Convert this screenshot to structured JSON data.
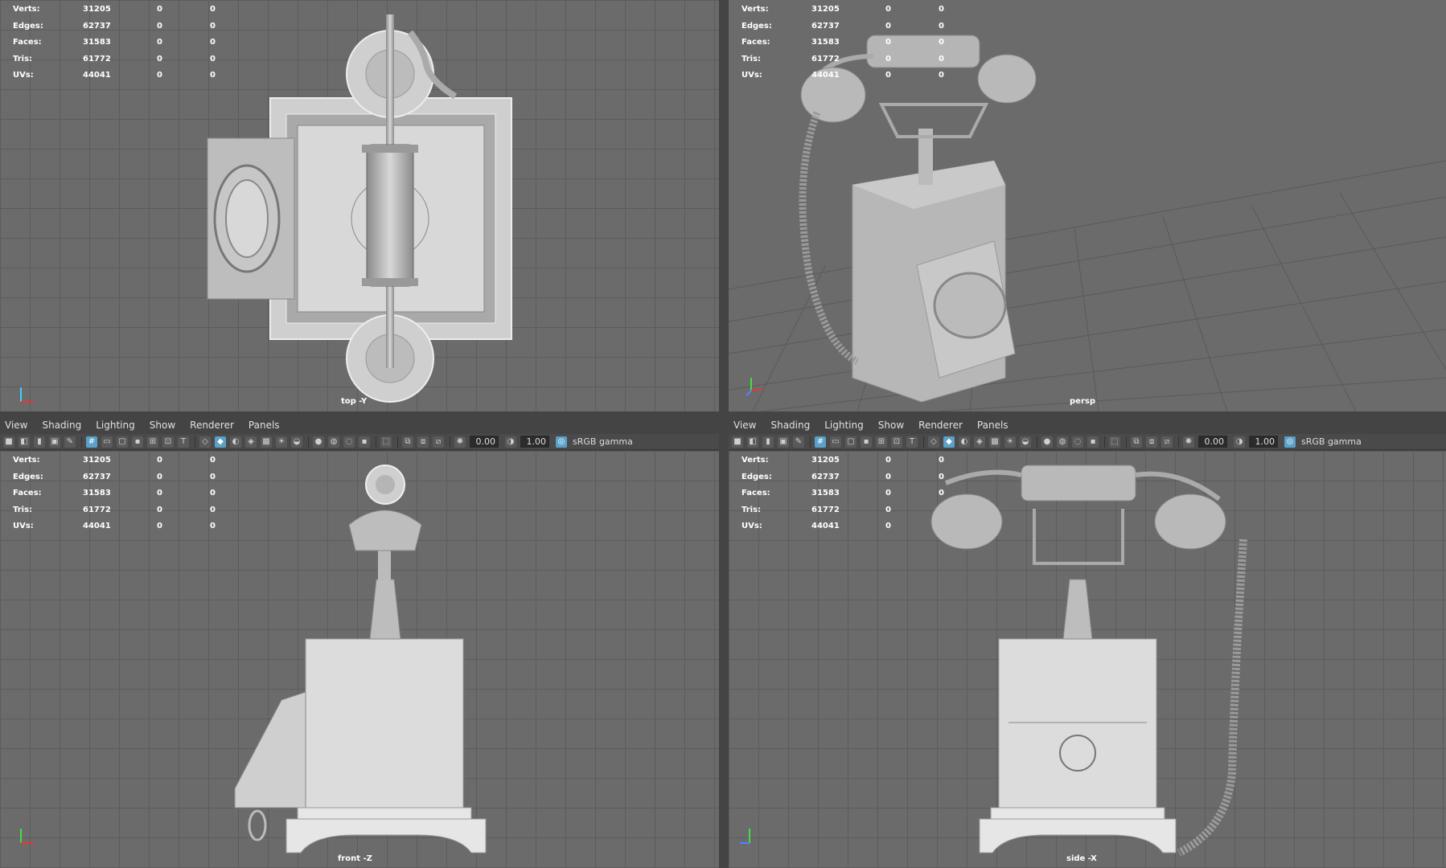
{
  "hud": {
    "labels": {
      "verts": "Verts:",
      "edges": "Edges:",
      "faces": "Faces:",
      "tris": "Tris:",
      "uvs": "UVs:"
    },
    "values": {
      "verts": [
        "31205",
        "0",
        "0"
      ],
      "edges": [
        "62737",
        "0",
        "0"
      ],
      "faces": [
        "31583",
        "0",
        "0"
      ],
      "tris": [
        "61772",
        "0",
        "0"
      ],
      "uvs": [
        "44041",
        "0",
        "0"
      ]
    }
  },
  "menu": {
    "view": "View",
    "shading": "Shading",
    "lighting": "Lighting",
    "show": "Show",
    "renderer": "Renderer",
    "panels": "Panels"
  },
  "toolbar": {
    "exposure": "0.00",
    "gamma": "1.00",
    "color_space": "sRGB gamma"
  },
  "cameras": {
    "top": "top -Y",
    "persp": "persp",
    "front": "front -Z",
    "side": "side -X"
  },
  "colors": {
    "viewport_bg": "#6b6b6b",
    "grid": "#5c5c5c",
    "panel": "#444444",
    "active_icon": "#5aa0c8"
  }
}
